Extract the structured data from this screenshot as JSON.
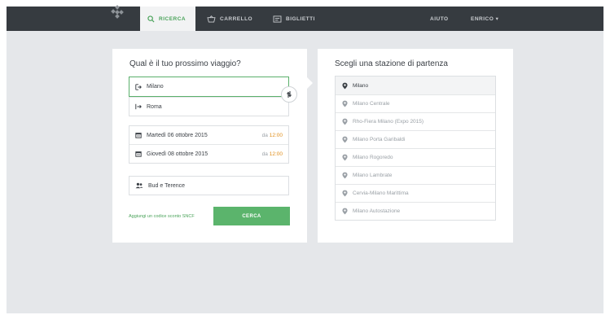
{
  "nav": {
    "search_label": "RICERCA",
    "cart_label": "CARRELLO",
    "tickets_label": "BIGLIETTI",
    "help_label": "AIUTO",
    "user_label": "ENRICO ▾",
    "active_color": "#4aa35a",
    "bar_color": "#363b40"
  },
  "search_form": {
    "title": "Qual è il tuo prossimo viaggio?",
    "origin": "Milano",
    "destination": "Roma",
    "outbound_date": "Martedì 06 ottobre 2015",
    "outbound_time_prefix": "da",
    "outbound_time": "12:00",
    "return_date": "Giovedì 08 ottobre 2015",
    "return_time_prefix": "da",
    "return_time": "12:00",
    "passengers": "Bud e Terence",
    "promo_link": "Aggiungi un codice sconto SNCF",
    "search_button": "CERCA"
  },
  "stations_panel": {
    "title": "Scegli una stazione di partenza",
    "stations": [
      "Milano",
      "Milano Centrale",
      "Rho-Fiera Milano (Expo 2015)",
      "Milano Porta Garibaldi",
      "Milano Rogoredo",
      "Milano Lambrate",
      "Cervia-Milano Marittima",
      "Milano Autostazione"
    ],
    "selected_index": 0
  }
}
